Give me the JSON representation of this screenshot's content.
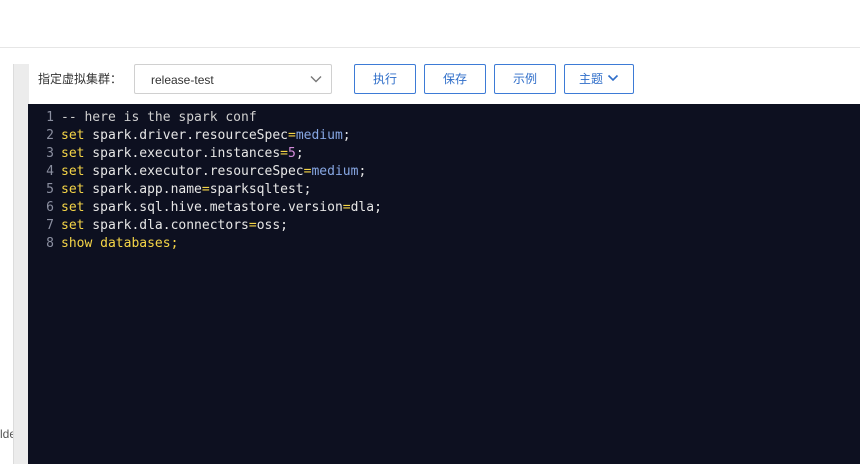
{
  "toolbar": {
    "cluster_label": "指定虚拟集群：",
    "cluster_value": "release-test",
    "run_label": "执行",
    "save_label": "保存",
    "example_label": "示例",
    "theme_label": "主题"
  },
  "side_stub": "lde",
  "editor": {
    "lines": [
      {
        "num": "1",
        "comment": "-- here is the spark conf"
      },
      {
        "num": "2",
        "kw": "set",
        "key": " spark.driver.resourceSpec",
        "op": "=",
        "val": "medium",
        "end": ";"
      },
      {
        "num": "3",
        "kw": "set",
        "key": " spark.executor.instances",
        "op": "=",
        "val": "5",
        "end": ";"
      },
      {
        "num": "4",
        "kw": "set",
        "key": " spark.executor.resourceSpec",
        "op": "=",
        "val": "medium",
        "end": ";"
      },
      {
        "num": "5",
        "kw": "set",
        "key": " spark.app.name",
        "op": "=",
        "val": "sparksqltest",
        "end": ";"
      },
      {
        "num": "6",
        "kw": "set",
        "key": " spark.sql.hive.metastore.version",
        "op": "=",
        "val": "dla",
        "end": ";"
      },
      {
        "num": "7",
        "kw": "set",
        "key": " spark.dla.connectors",
        "op": "=",
        "val": "oss",
        "end": ";"
      },
      {
        "num": "8",
        "kw": "show databases",
        "end": ";"
      }
    ]
  },
  "colors": {
    "editor_bg": "#0d1020",
    "keyword": "#f5d547",
    "number": "#d18ad8",
    "value": "#87a7e3",
    "button_accent": "#3d7bd6"
  }
}
